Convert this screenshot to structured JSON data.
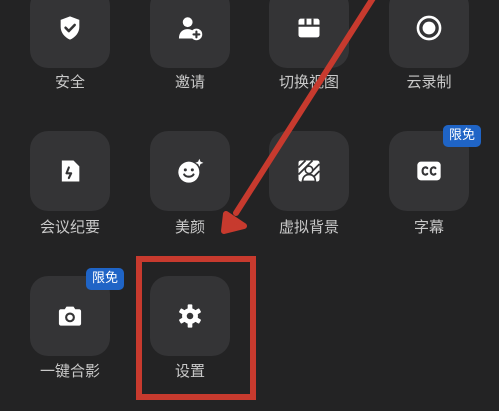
{
  "menu": {
    "items": [
      {
        "id": "security",
        "label": "安全"
      },
      {
        "id": "invite",
        "label": "邀请"
      },
      {
        "id": "switch-view",
        "label": "切换视图"
      },
      {
        "id": "cloud-record",
        "label": "云录制"
      },
      {
        "id": "minutes",
        "label": "会议纪要"
      },
      {
        "id": "beauty",
        "label": "美颜"
      },
      {
        "id": "virtual-background",
        "label": "虚拟背景"
      },
      {
        "id": "subtitles",
        "label": "字幕",
        "badge": "限免"
      },
      {
        "id": "one-tap-photo",
        "label": "一键合影",
        "badge": "限免"
      },
      {
        "id": "settings",
        "label": "设置"
      }
    ]
  },
  "icons": {
    "security": "shield-check-icon",
    "invite": "add-user-icon",
    "switch_view": "grid-view-icon",
    "cloud_record": "record-circle-icon",
    "minutes": "document-icon",
    "beauty": "smiley-sparkle-icon",
    "virtual_background": "portrait-background-icon",
    "subtitles": "cc-icon",
    "one_tap_photo": "camera-icon",
    "settings": "gear-icon"
  },
  "colors": {
    "background": "#232324",
    "tile": "#343436",
    "text": "#c9c9c9",
    "badge": "#1f64c6",
    "annotation": "#c73a2e"
  }
}
